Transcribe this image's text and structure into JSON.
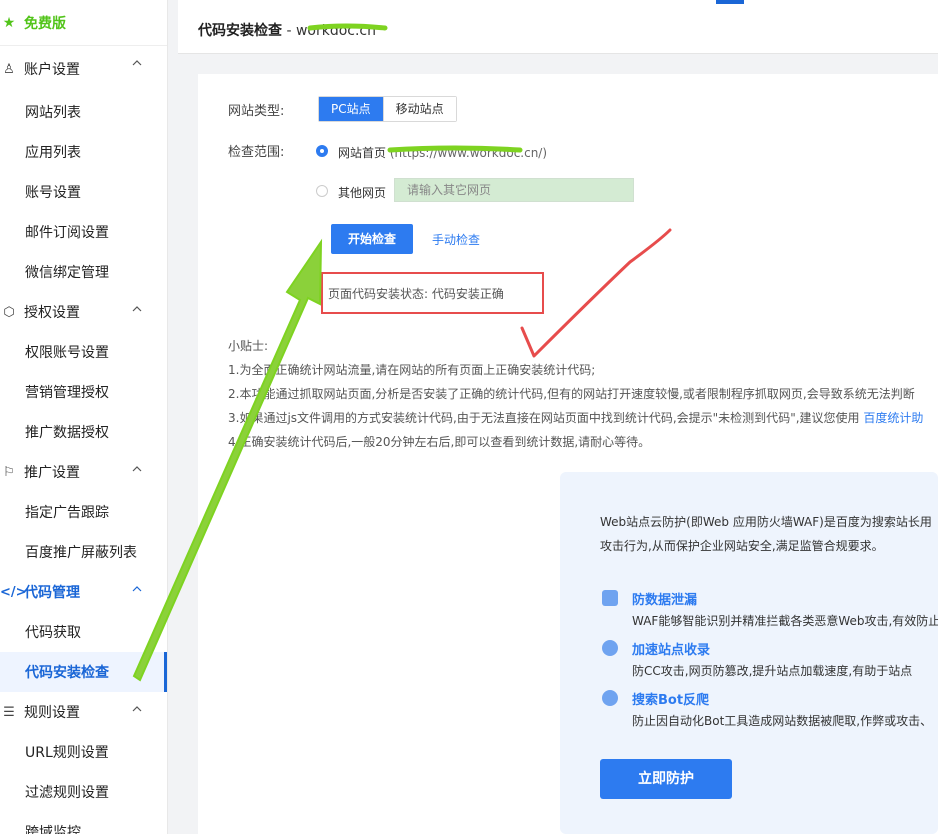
{
  "sidebar": {
    "edition": "免费版",
    "groups": [
      {
        "label": "账户设置",
        "items": [
          "网站列表",
          "应用列表",
          "账号设置",
          "邮件订阅设置",
          "微信绑定管理"
        ]
      },
      {
        "label": "授权设置",
        "items": [
          "权限账号设置",
          "营销管理授权",
          "推广数据授权"
        ]
      },
      {
        "label": "推广设置",
        "items": [
          "指定广告跟踪",
          "百度推广屏蔽列表"
        ]
      },
      {
        "label": "代码管理",
        "items": [
          "代码获取",
          "代码安装检查"
        ]
      },
      {
        "label": "规则设置",
        "items": [
          "URL规则设置",
          "过滤规则设置",
          "跨域监控"
        ]
      }
    ]
  },
  "header": {
    "title": "代码安装检查",
    "site": " - workdoc.cn"
  },
  "form": {
    "site_type_label": "网站类型:",
    "pc_tab": "PC站点",
    "mobile_tab": "移动站点",
    "scope_label": "检查范围:",
    "homepage_option": "网站首页",
    "homepage_url": "(https://www.workdoc.cn/)",
    "other_option": "其他网页",
    "other_placeholder": "请输入其它网页",
    "start_button": "开始检查",
    "manual_link": "手动检查",
    "status_text": "页面代码安装状态: 代码安装正确"
  },
  "tips": {
    "title": "小贴士:",
    "line1": "1.为全面正确统计网站流量,请在网站的所有页面上正确安装统计代码;",
    "line2": "2.本功能通过抓取网站页面,分析是否安装了正确的统计代码,但有的网站打开速度较慢,或者限制程序抓取网页,会导致系统无法判断",
    "line3": "3.如果通过js文件调用的方式安装统计代码,由于无法直接在网站页面中找到统计代码,会提示\"未检测到代码\",建议您使用 ",
    "line3_link": "百度统计助",
    "line4": "4.正确安装统计代码后,一般20分钟左右后,即可以查看到统计数据,请耐心等待。"
  },
  "promo": {
    "intro1": "Web站点云防护(即Web 应用防火墙WAF)是百度为搜索站长用",
    "intro2": "攻击行为,从而保护企业网站安全,满足监管合规要求。",
    "features": [
      {
        "title": "防数据泄漏",
        "desc": "WAF能够智能识别并精准拦截各类恶意Web攻击,有效防止"
      },
      {
        "title": "加速站点收录",
        "desc": "防CC攻击,网页防篡改,提升站点加载速度,有助于站点"
      },
      {
        "title": "搜索Bot反爬",
        "desc": "防止因自动化Bot工具造成网站数据被爬取,作弊或攻击、"
      }
    ],
    "button": "立即防护"
  },
  "colors": {
    "accent": "#2d7bf0",
    "annotation_green": "#7ed321",
    "annotation_red": "#e74c4c"
  }
}
